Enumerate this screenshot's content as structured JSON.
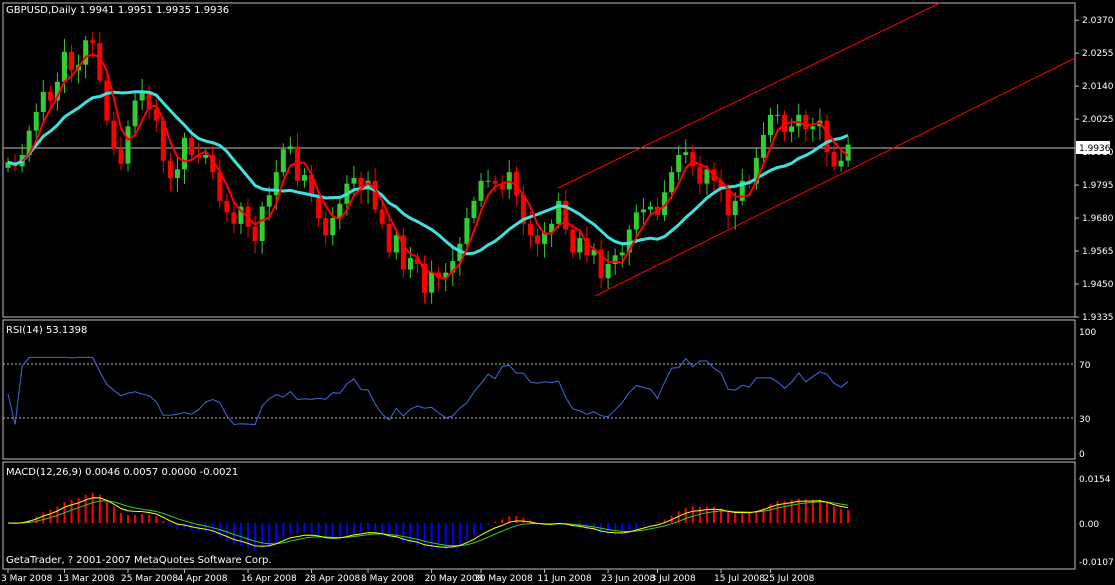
{
  "colors": {
    "background": "#000000",
    "grid_frame": "#c0c0c0",
    "bull_candle": "#32cd32",
    "bear_candle": "#ff0000",
    "ma_fast": "#ff0000",
    "ma_slow": "#40e0e0",
    "channel": "#ff0000",
    "rsi_line": "#4169e1",
    "macd_hist_pos": "#ff0000",
    "macd_hist_neg": "#0000ff",
    "macd_main": "#32cd32",
    "macd_signal": "#ffff00",
    "text": "#ffffff"
  },
  "main_panel": {
    "header": "GBPUSD,Daily  1.9941 1.9951 1.9935 1.9936",
    "current_price_label": "1.9936",
    "price_ticks": [
      "2.0370",
      "2.0255",
      "2.0140",
      "2.0025",
      "1.9910",
      "1.9795",
      "1.9680",
      "1.9565",
      "1.9450",
      "1.9335"
    ]
  },
  "rsi_panel": {
    "header": "RSI(14) 53.1398",
    "ticks": [
      "100",
      "70",
      "30",
      "0"
    ]
  },
  "macd_panel": {
    "header": "MACD(12,26,9) 0.0046 0.0057 0.0000 -0.0021",
    "ticks": [
      "0.0154",
      "0.00",
      "-0.0107"
    ]
  },
  "watermark": "GetaTrader, ? 2001-2007 MetaQuotes Software Corp.",
  "date_axis": [
    "3 Mar 2008",
    "13 Mar 2008",
    "25 Mar 2008",
    "4 Apr 2008",
    "16 Apr 2008",
    "28 Apr 2008",
    "8 May 2008",
    "20 May 2008",
    "30 May 2008",
    "11 Jun 2008",
    "23 Jun 2008",
    "3 Jul 2008",
    "15 Jul 2008",
    "25 Jul 2008"
  ],
  "chart_data": {
    "type": "candlestick",
    "symbol": "GBPUSD",
    "timeframe": "Daily",
    "ylim": [
      1.9335,
      2.043
    ],
    "closes": [
      1.9875,
      1.986,
      1.99,
      1.9985,
      2.005,
      2.012,
      2.009,
      2.0155,
      2.026,
      2.0195,
      2.0215,
      2.03,
      2.029,
      2.016,
      2.002,
      1.992,
      1.987,
      2.0,
      2.009,
      2.012,
      2.006,
      2.002,
      1.988,
      1.982,
      1.985,
      1.996,
      1.99,
      1.989,
      1.99,
      1.984,
      1.974,
      1.97,
      1.966,
      1.972,
      1.965,
      1.96,
      1.972,
      1.976,
      1.984,
      1.992,
      1.993,
      1.981,
      1.983,
      1.976,
      1.968,
      1.962,
      1.968,
      1.973,
      1.98,
      1.982,
      1.978,
      1.981,
      1.971,
      1.966,
      1.956,
      1.962,
      1.95,
      1.954,
      1.952,
      1.942,
      1.949,
      1.947,
      1.949,
      1.953,
      1.959,
      1.968,
      1.974,
      1.981,
      1.981,
      1.98,
      1.978,
      1.984,
      1.976,
      1.966,
      1.962,
      1.959,
      1.963,
      1.966,
      1.974,
      1.964,
      1.956,
      1.961,
      1.955,
      1.957,
      1.947,
      1.952,
      1.955,
      1.956,
      1.964,
      1.97,
      1.971,
      1.972,
      1.969,
      1.977,
      1.984,
      1.99,
      1.991,
      1.986,
      1.98,
      1.985,
      1.981,
      1.978,
      1.969,
      1.974,
      1.981,
      1.98,
      1.989,
      1.997,
      2.004,
      2.004,
      1.998,
      2.0,
      2.004,
      1.999,
      2.0,
      2.002,
      1.991,
      1.986,
      1.988,
      1.9936
    ]
  }
}
